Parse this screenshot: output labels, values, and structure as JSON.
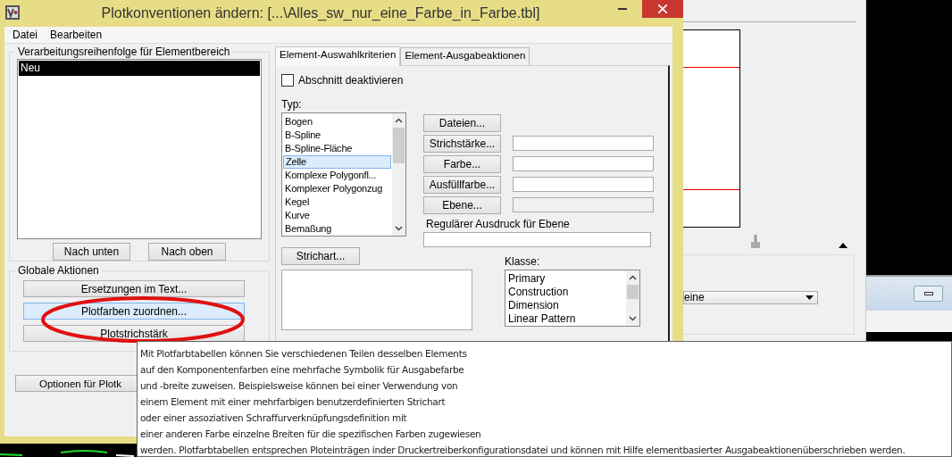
{
  "window": {
    "title": "Plotkonventionen ändern: [...\\Alles_sw_nur_eine_Farbe_in_Farbe.tbl]"
  },
  "menu": [
    "Datei",
    "Bearbeiten"
  ],
  "order_group": {
    "title": "Verarbeitungsreihenfolge für Elementbereich",
    "items": [
      {
        "label": "Neu",
        "selected": true
      }
    ],
    "buttons": [
      "Nach unten",
      "Nach oben"
    ]
  },
  "global_actions": {
    "title": "Globale Aktionen",
    "buttons": [
      {
        "label": "Ersetzungen im Text...",
        "highlighted": false
      },
      {
        "label": "Plotfarben zuordnen...",
        "highlighted": true
      },
      {
        "label": "Plotstrichstärk",
        "highlighted": false
      }
    ]
  },
  "options_button": "Optionen für Plotk",
  "tabs": [
    {
      "label": "Element-Auswahlkriterien",
      "selected": true
    },
    {
      "label": "Element-Ausgabeaktionen",
      "selected": false
    }
  ],
  "section_disabled": {
    "label": "Abschnitt deaktivieren",
    "checked": false
  },
  "type_list": {
    "label": "Typ:",
    "items": [
      {
        "label": "Bogen",
        "selected": false
      },
      {
        "label": "B-Spline",
        "selected": false
      },
      {
        "label": "B-Spline-Fläche",
        "selected": false
      },
      {
        "label": "Zelle",
        "selected": true
      },
      {
        "label": "Komplexe Polygonfl...",
        "selected": false
      },
      {
        "label": "Komplexer Polygonzug",
        "selected": false
      },
      {
        "label": "Kegel",
        "selected": false
      },
      {
        "label": "Kurve",
        "selected": false
      },
      {
        "label": "Bemaßung",
        "selected": false
      }
    ]
  },
  "attribute_rows": [
    {
      "label": "Dateien...",
      "kind": "button"
    },
    {
      "label": "Strichstärke...",
      "kind": "field"
    },
    {
      "label": "Farbe...",
      "kind": "field"
    },
    {
      "label": "Ausfüllfarbe...",
      "kind": "field"
    },
    {
      "label": "Ebene...",
      "kind": "readonly"
    }
  ],
  "regex": {
    "label": "Regulärer Ausdruck für Ebene"
  },
  "linestyle_button": "Strichart...",
  "class_list": {
    "label": "Klasse:",
    "items": [
      "Primary",
      "Construction",
      "Dimension",
      "Linear Pattern"
    ]
  },
  "background": {
    "dropdown_value": "eine"
  },
  "tooltip": {
    "lines": [
      "Mit Plotfarbtabellen können Sie verschiedenen Teilen desselben Elements",
      "auf den Komponentenfarben eine mehrfache Symbolik für Ausgabefarbe",
      "und -breite zuweisen. Beispielsweise können bei einer Verwendung von",
      "einem Element mit einer mehrfarbigen benutzerdefinierten Strichart",
      "oder einer assoziativen Schraffurverknüpfungsdefinition mit",
      "einer anderen Farbe einzelne Breiten für die spezifischen Farben zugewiesen",
      "werden. Plotfarbtabellen entsprechen Ploteinträgen inder Druckertreiberkonfigurationsdatei und können mit Hilfe elementbasierter Ausgabeaktionenüberschrieben werden."
    ]
  }
}
